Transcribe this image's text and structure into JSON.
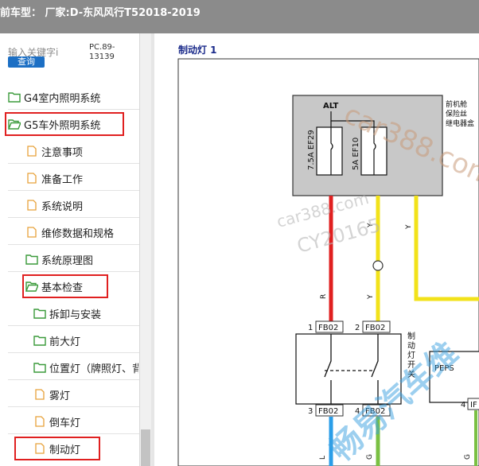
{
  "titlebar": {
    "title": "前车型：  厂家:D-东风风行T52018-2019"
  },
  "sidebar": {
    "search_placeholder": "输入关键字i",
    "search_button": "查询",
    "page_ref": "PC.89-13139",
    "items": [
      {
        "label": "G4室内照明系统",
        "icon": "folder-icon"
      },
      {
        "label": "G5车外照明系统",
        "icon": "folder-open-icon"
      },
      {
        "label": "注意事项",
        "icon": "document-icon"
      },
      {
        "label": "准备工作",
        "icon": "document-icon"
      },
      {
        "label": "系统说明",
        "icon": "document-icon"
      },
      {
        "label": "维修数据和规格",
        "icon": "document-icon"
      },
      {
        "label": "系统原理图",
        "icon": "folder-icon"
      },
      {
        "label": "基本检查",
        "icon": "folder-open-icon"
      },
      {
        "label": "拆卸与安装",
        "icon": "folder-icon"
      },
      {
        "label": "前大灯",
        "icon": "folder-icon"
      },
      {
        "label": "位置灯（牌照灯、背",
        "icon": "folder-icon"
      },
      {
        "label": "雾灯",
        "icon": "document-icon"
      },
      {
        "label": "倒车灯",
        "icon": "document-icon"
      },
      {
        "label": "制动灯",
        "icon": "document-icon"
      }
    ]
  },
  "diagram": {
    "title": "制动灯 1",
    "alt_label": "ALT",
    "fuse1": "7.5A EF29",
    "fuse2": "5A EF10",
    "fusebox_label": [
      "前机舱",
      "保险丝",
      "继电器盒"
    ],
    "wire_r": "R",
    "wire_y1": "Y",
    "wire_y2": "Y",
    "wire_y3": "Y",
    "pin1": "1",
    "conn1": "FB02",
    "pin2": "2",
    "conn2": "FB02",
    "switch_label": [
      "制",
      "动",
      "灯",
      "开",
      "关"
    ],
    "pin3": "3",
    "conn3": "FB02",
    "pin4": "4",
    "conn4": "FB02",
    "wire_l": "L",
    "wire_g1": "G",
    "wire_g2": "G",
    "peps_label": "PEPS",
    "pin_peps": "4",
    "conn_peps": "IF",
    "watermark1": "car388.com",
    "watermark2": "car388.com",
    "watermark3": "CY20165",
    "watermark4": "畅易汽车维"
  },
  "colors": {
    "titlebar": "#8b8b8b",
    "fusebox": "#c8c8c8",
    "wire_red": "#e02020",
    "wire_yellow": "#f2e21a",
    "wire_blue": "#2a9ee8",
    "wire_green": "#7ac043",
    "highlight": "#e02020"
  }
}
